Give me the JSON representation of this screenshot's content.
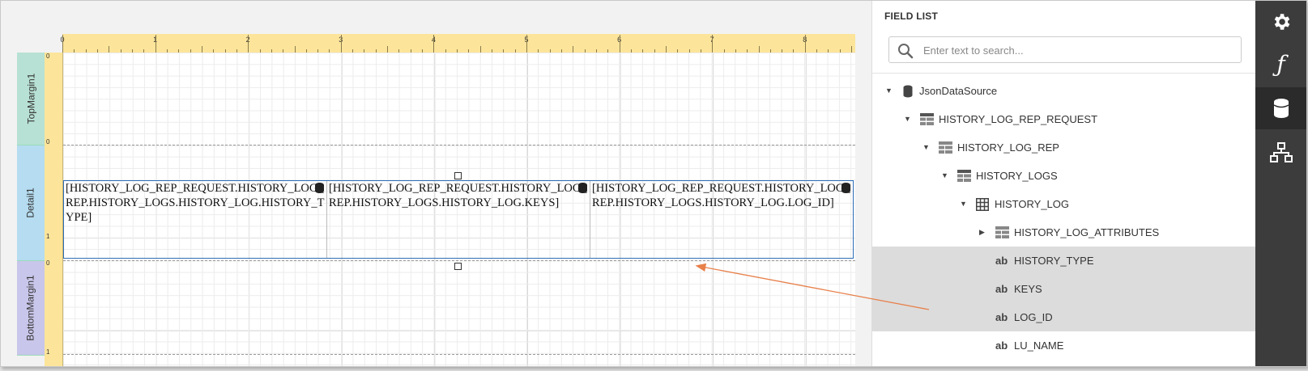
{
  "designer": {
    "ruler_numbers": [
      "0",
      "1",
      "2",
      "3",
      "4",
      "5",
      "6",
      "7",
      "8"
    ],
    "vruler_numbers": {
      "top": "0",
      "detail_top": "0",
      "detail_mark": "1",
      "bottom_top": "0",
      "bottom_end": "1"
    },
    "bands": {
      "top_margin": "TopMargin1",
      "detail": "Detail1",
      "bottom_margin": "BottomMargin1"
    },
    "cells": [
      "[HISTORY_LOG_REP_REQUEST.HISTORY_LOG_REP.HISTORY_LOGS.HISTORY_LOG.HISTORY_TYPE]",
      "[HISTORY_LOG_REP_REQUEST.HISTORY_LOG_REP.HISTORY_LOGS.HISTORY_LOG.KEYS]",
      "[HISTORY_LOG_REP_REQUEST.HISTORY_LOG_REP.HISTORY_LOGS.HISTORY_LOG.LOG_ID]"
    ],
    "annotation_color": "#e8804a",
    "selection_color": "#2e6eb5"
  },
  "field_list": {
    "title": "FIELD LIST",
    "search_placeholder": "Enter text to search...",
    "items": [
      {
        "label": "JsonDataSource",
        "icon": "database-icon"
      },
      {
        "label": "HISTORY_LOG_REP_REQUEST",
        "icon": "list-icon"
      },
      {
        "label": "HISTORY_LOG_REP",
        "icon": "list-icon"
      },
      {
        "label": "HISTORY_LOGS",
        "icon": "list-icon"
      },
      {
        "label": "HISTORY_LOG",
        "icon": "grid-icon"
      },
      {
        "label": "HISTORY_LOG_ATTRIBUTES",
        "icon": "list-icon"
      },
      {
        "label": "HISTORY_TYPE",
        "icon": "ab"
      },
      {
        "label": "KEYS",
        "icon": "ab"
      },
      {
        "label": "LOG_ID",
        "icon": "ab"
      },
      {
        "label": "LU_NAME",
        "icon": "ab"
      }
    ]
  },
  "toolbar": {
    "buttons": [
      "gear-icon",
      "function-icon",
      "database-icon",
      "hierarchy-icon"
    ],
    "function_glyph": "ƒ"
  }
}
